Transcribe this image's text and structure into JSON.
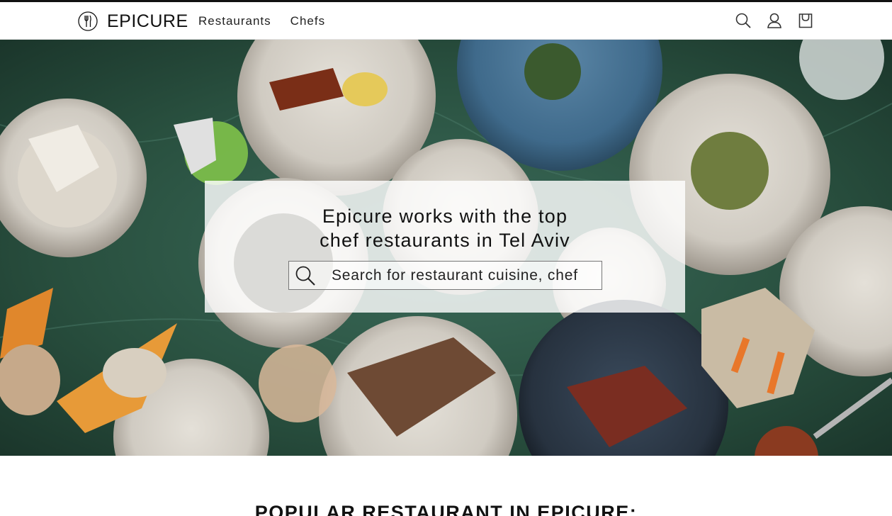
{
  "brand": {
    "name": "EPICURE"
  },
  "nav": {
    "links": [
      {
        "label": "Restaurants"
      },
      {
        "label": "Chefs"
      }
    ],
    "icons": [
      "search-icon",
      "user-icon",
      "shopping-bag-icon"
    ]
  },
  "hero": {
    "title_line1": "Epicure works with the top",
    "title_line2": "chef restaurants in Tel Aviv",
    "search": {
      "placeholder": "Search for restaurant cuisine, chef",
      "value": ""
    }
  },
  "sections": {
    "popular_title": "POPULAR RESTAURANT IN EPICURE:"
  },
  "colors": {
    "accent": "#111111",
    "hero_table": "#244a3e"
  }
}
